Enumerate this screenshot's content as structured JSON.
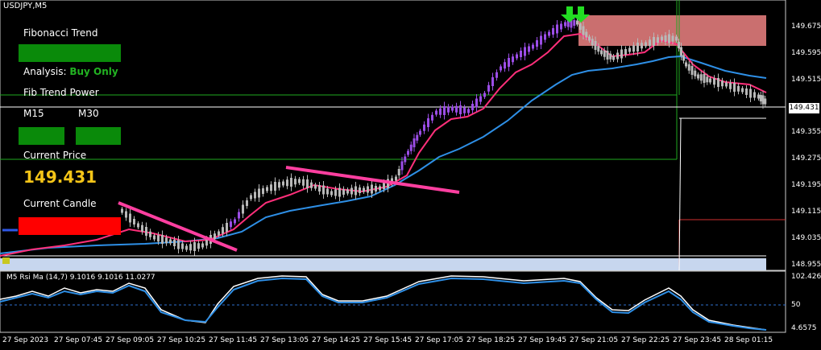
{
  "window": {
    "symbol_label": "USDJPY,M5"
  },
  "panel": {
    "fib_trend_label": "Fibonacci Trend",
    "analysis_label": "Analysis:",
    "analysis_value": "Buy Only",
    "fib_power_label": "Fib Trend Power",
    "tf1_label": "M15",
    "tf2_label": "M30",
    "current_price_label": "Current Price",
    "current_price_value": "149.431",
    "current_candle_label": "Current Candle",
    "colors": {
      "trend_box": "#0a8a0a",
      "candle_box": "#ff0000",
      "analysis_value": "#22b322",
      "price": "#f5c518"
    }
  },
  "price_axis": {
    "labels": [
      "149.675",
      "149.595",
      "149.515",
      "149.431",
      "149.355",
      "149.275",
      "149.195",
      "149.115",
      "149.035",
      "148.955"
    ],
    "current_price": "149.431"
  },
  "time_axis": {
    "labels": [
      "27 Sep 2023",
      "27 Sep 07:45",
      "27 Sep 09:05",
      "27 Sep 10:25",
      "27 Sep 11:45",
      "27 Sep 13:05",
      "27 Sep 14:25",
      "27 Sep 15:45",
      "27 Sep 17:05",
      "27 Sep 18:25",
      "27 Sep 19:45",
      "27 Sep 21:05",
      "27 Sep 22:25",
      "27 Sep 23:45",
      "28 Sep 01:15"
    ]
  },
  "rsi": {
    "title": "M5  Rsi Ma (14,7) 9.1016 9.1016 11.0277",
    "labels": [
      "102.4262",
      "50",
      "4.6575"
    ]
  }
}
